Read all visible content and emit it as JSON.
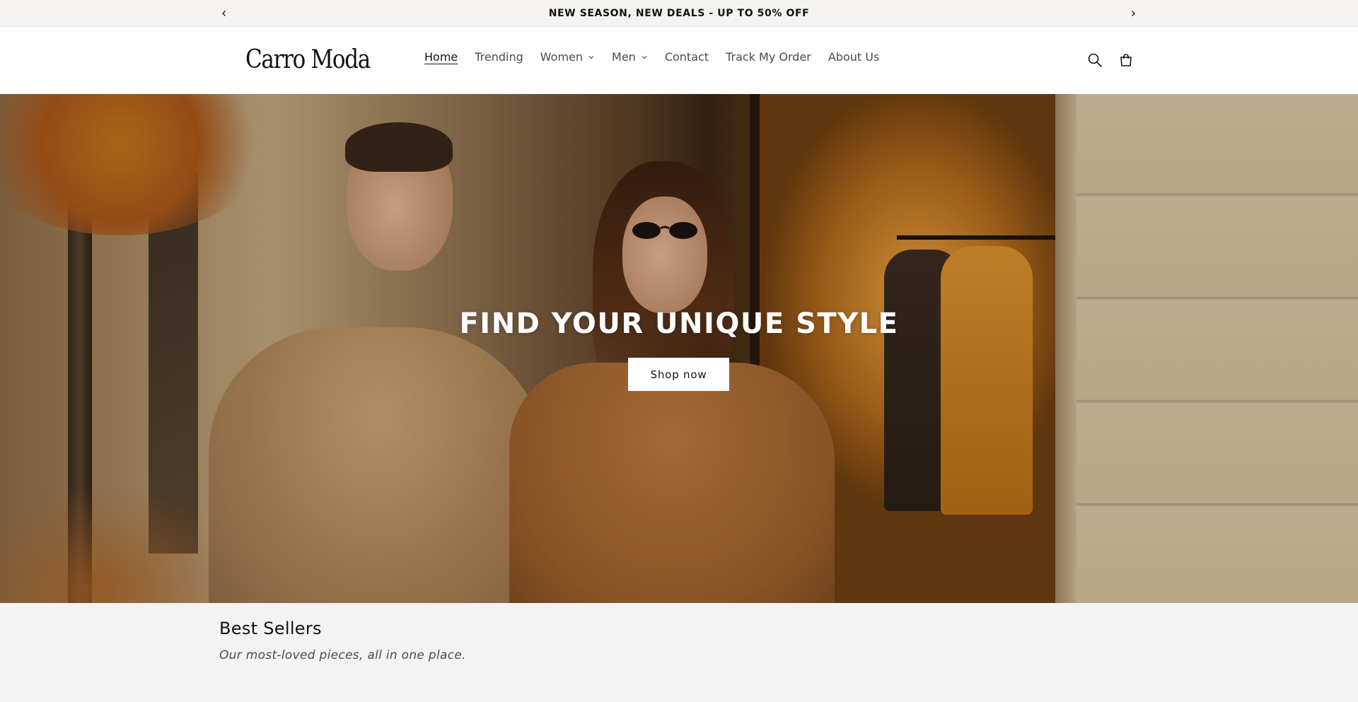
{
  "announcement": {
    "text": "NEW SEASON, NEW DEALS - UP TO 50% OFF",
    "prev_icon": "chevron-left-icon",
    "next_icon": "chevron-right-icon"
  },
  "header": {
    "logo": "Carro Moda",
    "nav": [
      {
        "label": "Home",
        "active": true
      },
      {
        "label": "Trending"
      },
      {
        "label": "Women",
        "has_dropdown": true
      },
      {
        "label": "Men",
        "has_dropdown": true
      },
      {
        "label": "Contact"
      },
      {
        "label": "Track My Order"
      },
      {
        "label": "About Us"
      }
    ],
    "icons": [
      "search-icon",
      "cart-icon"
    ]
  },
  "hero": {
    "title": "FIND YOUR UNIQUE STYLE",
    "button_label": "Shop now"
  },
  "best_sellers": {
    "title": "Best Sellers",
    "subtitle": "Our most-loved pieces, all in one place."
  },
  "colors": {
    "announcement_bg": "#f4f3f0",
    "text": "#121212",
    "nav_text": "#4a4a4a",
    "section_bg": "#f3f3f3",
    "button_bg": "#ffffff"
  }
}
